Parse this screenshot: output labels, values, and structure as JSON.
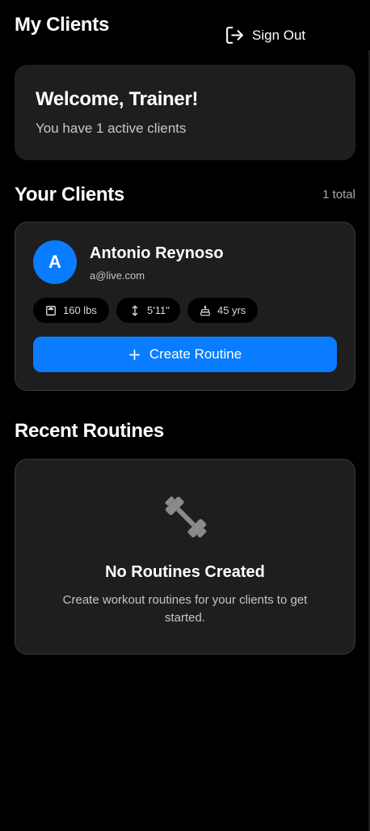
{
  "header": {
    "title": "My Clients",
    "signout_label": "Sign Out",
    "signout_icon": "logout-icon"
  },
  "welcome": {
    "title": "Welcome, Trainer!",
    "subtitle": "You have 1 active clients"
  },
  "clients_section": {
    "title": "Your Clients",
    "total": "1 total",
    "clients": [
      {
        "initial": "A",
        "name": "Antonio Reynoso",
        "email": "a@live.com",
        "weight": "160 lbs",
        "height": "5'11\"",
        "age": "45 yrs",
        "create_label": "Create Routine"
      }
    ]
  },
  "routines_section": {
    "title": "Recent Routines",
    "empty_title": "No Routines Created",
    "empty_description": "Create workout routines for your clients to get started.",
    "empty_icon": "dumbbell-icon"
  },
  "colors": {
    "background": "#000000",
    "card": "#1e1e1e",
    "accent": "#0a7cff",
    "border": "#3a3a3a"
  }
}
